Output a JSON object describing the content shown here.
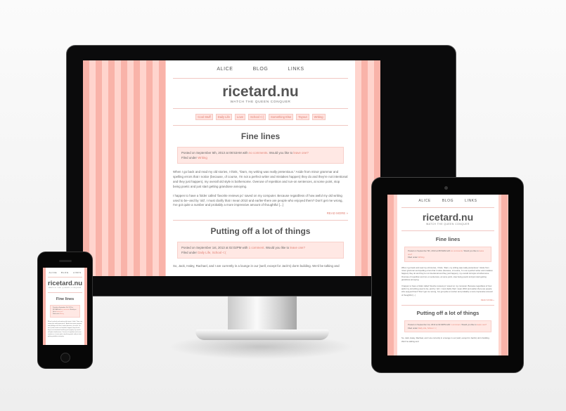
{
  "site": {
    "title": "ricetard.nu",
    "tagline": "WATCH THE QUEEN CONQUER",
    "nav": [
      "ALICE",
      "BLOG",
      "LINKS"
    ],
    "categories": [
      "Cool Stuff",
      "Daily Life",
      "Love",
      "School <:(",
      "Something Else",
      "Tayout",
      "Writing"
    ]
  },
  "posts": [
    {
      "title": "Fine lines",
      "meta_prefix": "Posted on September 5th, 2013 at 08:53AM with",
      "comments_link": "no comments",
      "meta_mid": ". Would you like to",
      "leave_link": "leave one?",
      "filed_prefix": "Filed under",
      "filed_link": "Writing",
      "para1": "When I go back and read my old stories, I think, \"Darn, my writing was really pretentious.\" Aside from minor grammar and spelling errors that I notice (because, of course, I'm not a perfect writer and mistakes happen) they do and they're not intentional and they just happen), my overall old style is bothersome. Overuse of repetition and run-on sentences, at some point, stop being poetic and just start getting grandiose annoying.",
      "para2": "I happen to have a folder called 'favorite reviews pc' saved on my computer. Because regardless of how awful my old writing used to be--and by 'old', I must clarify that I mean 2010 and earlier-there are people who enjoyed them? Don't get me wrong, I've got quite a number and probably a more impressive amount of thoughtful [...]",
      "read_more": "READ MORE »"
    },
    {
      "title": "Putting off a lot of things",
      "meta_prefix": "Posted on September 1st, 2013 at 02:02PM with",
      "comments_link": "1 comment",
      "meta_mid": ". Would you like to",
      "leave_link": "leave one?",
      "filed_prefix": "Filed under",
      "filed_link": "Daily Life, School <:(",
      "para1": "So, Jack, Haley, Rachael, and I are currently in a lounge in our (well, except for Jack's) dorm building. We'd be talking and"
    }
  ],
  "colors": {
    "stripe_dark": "#f9b3a9",
    "stripe_light": "#ffd4cd",
    "accent": "#e07f72",
    "meta_bg": "#ffe8e4"
  }
}
